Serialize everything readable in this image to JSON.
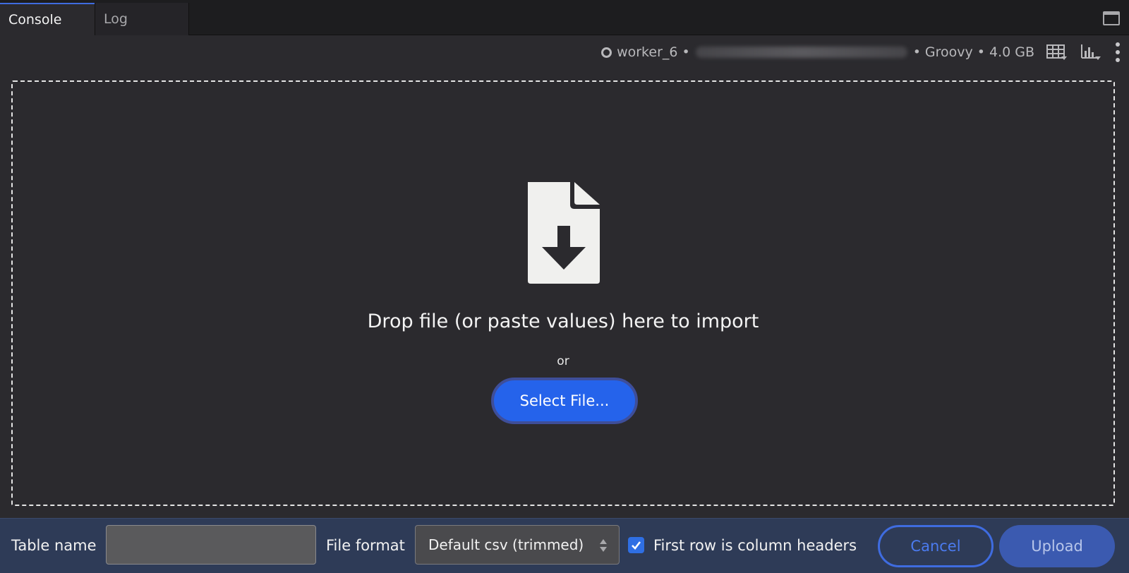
{
  "tabs": [
    {
      "label": "Console",
      "active": true
    },
    {
      "label": "Log",
      "active": false
    }
  ],
  "status": {
    "worker": "worker_6",
    "separator": "•",
    "language": "Groovy",
    "memory": "4.0 GB"
  },
  "dropzone": {
    "message": "Drop file (or paste values) here to import",
    "or_text": "or",
    "select_button": "Select File..."
  },
  "bottom": {
    "table_name_label": "Table name",
    "table_name_value": "",
    "file_format_label": "File format",
    "file_format_value": "Default csv (trimmed)",
    "checkbox_label": "First row is column headers",
    "checkbox_checked": true,
    "cancel_label": "Cancel",
    "upload_label": "Upload"
  },
  "colors": {
    "accent": "#2563eb",
    "bottom_bar": "#2e3b57",
    "panel": "#2b2a2e"
  }
}
